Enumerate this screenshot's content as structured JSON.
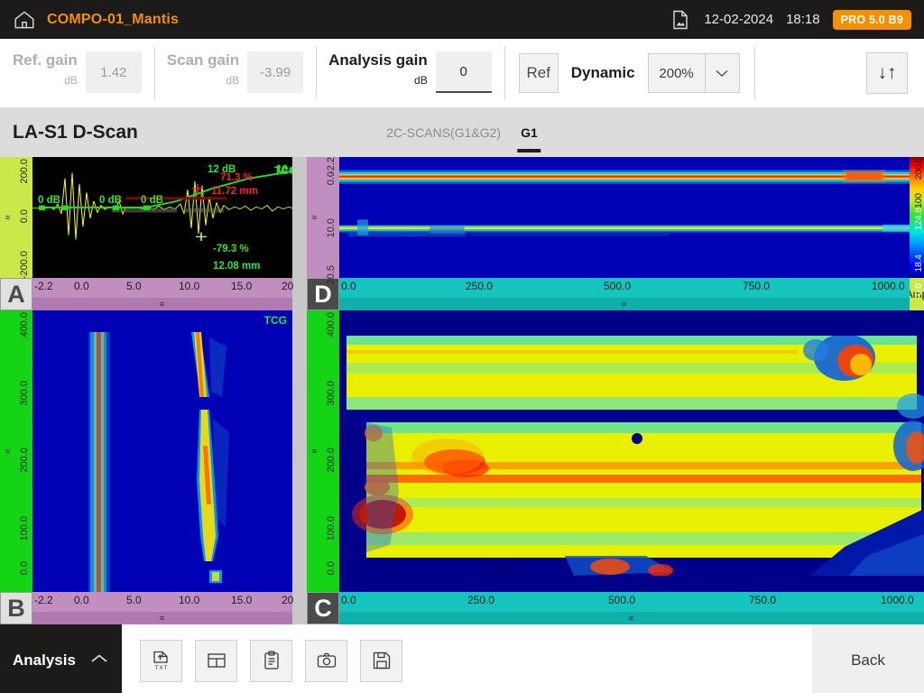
{
  "topbar": {
    "home_icon": "home-icon",
    "project_title": "COMPO-01_Mantis",
    "file_icon": "image-file-icon",
    "date": "12-02-2024",
    "time": "18:18",
    "version_badge": "PRO 5.0 B9"
  },
  "toolbar": {
    "ref_gain": {
      "label": "Ref. gain",
      "unit": "dB",
      "value": "1.42",
      "enabled": false
    },
    "scan_gain": {
      "label": "Scan gain",
      "unit": "dB",
      "value": "-3.99",
      "enabled": false
    },
    "analysis_gain": {
      "label": "Analysis gain",
      "unit": "dB",
      "value": "0",
      "enabled": true
    },
    "ref_button": "Ref",
    "dynamic_label": "Dynamic",
    "dynamic_value": "200%",
    "dynamic_options": [
      "200%"
    ],
    "flip_button_icon": "sort-updown-icon",
    "flip_button_glyph": "↓↑"
  },
  "view": {
    "title": "LA-S1 D-Scan",
    "tabs": [
      {
        "label": "2C-SCANS(G1&G2)",
        "active": false
      },
      {
        "label": "G1",
        "active": true
      }
    ]
  },
  "panels": {
    "a_scan": {
      "letter": "A",
      "y_ticks": [
        "200.0",
        "0.0",
        "-200.0"
      ],
      "x_ticks": [
        "-2.2",
        "0.0",
        "5.0",
        "10.0",
        "15.0",
        "20"
      ],
      "tcg_tag": "TCG",
      "annotations": [
        {
          "text": "0 dB",
          "color": "green"
        },
        {
          "text": "0 dB",
          "color": "green"
        },
        {
          "text": "0 dB",
          "color": "green"
        },
        {
          "text": "12 dB",
          "color": "green"
        },
        {
          "text": "16 dB",
          "color": "green"
        },
        {
          "text": "71.3 %",
          "color": "red"
        },
        {
          "text": "11.72 mm",
          "color": "red"
        },
        {
          "text": "-79.3 %",
          "color": "green"
        },
        {
          "text": "12.08 mm",
          "color": "green"
        }
      ]
    },
    "d_scan": {
      "letter": "D",
      "y_ticks": [
        "-2.2",
        "0.0",
        "10.0",
        "20.5"
      ],
      "x_ticks": [
        "0.0",
        "250.0",
        "500.0",
        "750.0",
        "1000.0"
      ]
    },
    "b_scan": {
      "letter": "B",
      "y_ticks": [
        "400.0",
        "300.0",
        "200.0",
        "100.0",
        "0.0"
      ],
      "x_ticks": [
        "-2.2",
        "0.0",
        "5.0",
        "10.0",
        "15.0",
        "20"
      ],
      "tcg_tag": "TCG"
    },
    "c_scan": {
      "letter": "C",
      "y_ticks": [
        "400.0",
        "300.0",
        "200.0",
        "100.0",
        "0.0"
      ],
      "x_ticks": [
        "0.0",
        "250.0",
        "500.0",
        "750.0",
        "1000.0"
      ]
    },
    "amp_scale": {
      "label": "Amp",
      "ticks": [
        "200.0",
        "100",
        "124.8",
        "18.4",
        "0.0"
      ]
    }
  },
  "bottombar": {
    "analysis_label": "Analysis",
    "collapse_icon": "chevron-up-icon",
    "tools": [
      {
        "icon": "export-txt-icon",
        "name": "export-txt-button"
      },
      {
        "icon": "layout-icon",
        "name": "layout-button"
      },
      {
        "icon": "clipboard-icon",
        "name": "report-button"
      },
      {
        "icon": "camera-icon",
        "name": "screenshot-button"
      },
      {
        "icon": "save-icon",
        "name": "save-button"
      }
    ],
    "back_label": "Back"
  },
  "colors": {
    "accent_orange": "#f49100",
    "dark_bar": "#1c1b19",
    "green_rail": "#15d415",
    "yellow_rail": "#cbe84b",
    "purple_rail": "#c08fc0",
    "teal_rail": "#14c4bd"
  }
}
